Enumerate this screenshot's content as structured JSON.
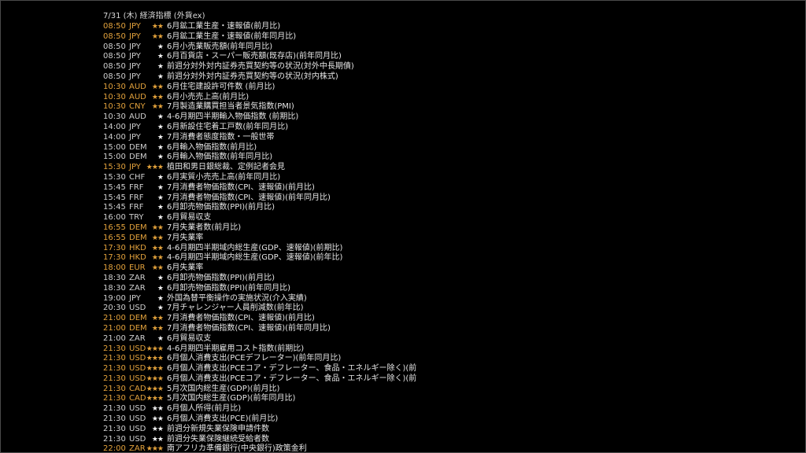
{
  "header": "7/31 (木) 経済指標 (外貨ex)",
  "colors": {
    "normal": "#cfcfcf",
    "highlight": "#e3a23c",
    "text": "#e6e6e6",
    "background": "#000000"
  },
  "rows": [
    {
      "time": "08:50",
      "currency": "JPY",
      "stars": "★★",
      "title": "6月鉱工業生産・速報値(前月比)",
      "hl": true
    },
    {
      "time": "08:50",
      "currency": "JPY",
      "stars": "★★",
      "title": "6月鉱工業生産・速報値(前年同月比)",
      "hl": true
    },
    {
      "time": "08:50",
      "currency": "JPY",
      "stars": "★",
      "title": "6月小売業販売額(前年同月比)",
      "hl": false
    },
    {
      "time": "08:50",
      "currency": "JPY",
      "stars": "★",
      "title": "6月百貨店・スーパー販売額(既存店)(前年同月比)",
      "hl": false
    },
    {
      "time": "08:50",
      "currency": "JPY",
      "stars": "★",
      "title": "前週分対外対内証券売買契約等の状況(対外中長期債)",
      "hl": false
    },
    {
      "time": "08:50",
      "currency": "JPY",
      "stars": "★",
      "title": "前週分対外対内証券売買契約等の状況(対内株式)",
      "hl": false
    },
    {
      "time": "10:30",
      "currency": "AUD",
      "stars": "★★",
      "title": "6月住宅建設許可件数 (前月比)",
      "hl": true
    },
    {
      "time": "10:30",
      "currency": "AUD",
      "stars": "★★",
      "title": "6月小売売上高(前月比)",
      "hl": true
    },
    {
      "time": "10:30",
      "currency": "CNY",
      "stars": "★★",
      "title": "7月製造業購買担当者景気指数(PMI)",
      "hl": true
    },
    {
      "time": "10:30",
      "currency": "AUD",
      "stars": "★",
      "title": "4-6月期四半期輸入物価指数 (前期比)",
      "hl": false
    },
    {
      "time": "14:00",
      "currency": "JPY",
      "stars": "★",
      "title": "6月新設住宅着工戸数(前年同月比)",
      "hl": false
    },
    {
      "time": "14:00",
      "currency": "JPY",
      "stars": "★",
      "title": "7月消費者態度指数・一般世帯",
      "hl": false
    },
    {
      "time": "15:00",
      "currency": "DEM",
      "stars": "★",
      "title": "6月輸入物価指数(前月比)",
      "hl": false
    },
    {
      "time": "15:00",
      "currency": "DEM",
      "stars": "★",
      "title": "6月輸入物価指数(前年同月比)",
      "hl": false
    },
    {
      "time": "15:30",
      "currency": "JPY",
      "stars": "★★★",
      "title": "植田和男日銀総裁、定例記者会見",
      "hl": true
    },
    {
      "time": "15:30",
      "currency": "CHF",
      "stars": "★",
      "title": "6月実質小売売上高(前年同月比)",
      "hl": false
    },
    {
      "time": "15:45",
      "currency": "FRF",
      "stars": "★",
      "title": "7月消費者物価指数(CPI、速報値)(前月比)",
      "hl": false
    },
    {
      "time": "15:45",
      "currency": "FRF",
      "stars": "★",
      "title": "7月消費者物価指数(CPI、速報値)(前年同月比)",
      "hl": false
    },
    {
      "time": "15:45",
      "currency": "FRF",
      "stars": "★",
      "title": "6月卸売物価指数(PPI)(前月比)",
      "hl": false
    },
    {
      "time": "16:00",
      "currency": "TRY",
      "stars": "★",
      "title": "6月貿易収支",
      "hl": false
    },
    {
      "time": "16:55",
      "currency": "DEM",
      "stars": "★★",
      "title": "7月失業者数(前月比)",
      "hl": true
    },
    {
      "time": "16:55",
      "currency": "DEM",
      "stars": "★★",
      "title": "7月失業率",
      "hl": true
    },
    {
      "time": "17:30",
      "currency": "HKD",
      "stars": "★★",
      "title": "4-6月期四半期域内総生産(GDP、速報値)(前期比)",
      "hl": true
    },
    {
      "time": "17:30",
      "currency": "HKD",
      "stars": "★★",
      "title": "4-6月期四半期域内総生産(GDP、速報値)(前年比)",
      "hl": true
    },
    {
      "time": "18:00",
      "currency": "EUR",
      "stars": "★★",
      "title": "6月失業率",
      "hl": true
    },
    {
      "time": "18:30",
      "currency": "ZAR",
      "stars": "★",
      "title": "6月卸売物価指数(PPI)(前月比)",
      "hl": false
    },
    {
      "time": "18:30",
      "currency": "ZAR",
      "stars": "★",
      "title": "6月卸売物価指数(PPI)(前年同月比)",
      "hl": false
    },
    {
      "time": "19:00",
      "currency": "JPY",
      "stars": "★",
      "title": "外国為替平衡操作の実施状況(介入実績)",
      "hl": false
    },
    {
      "time": "20:30",
      "currency": "USD",
      "stars": "★",
      "title": "7月チャレンジャー人員削減数(前年比)",
      "hl": false
    },
    {
      "time": "21:00",
      "currency": "DEM",
      "stars": "★★",
      "title": "7月消費者物価指数(CPI、速報値)(前月比)",
      "hl": true
    },
    {
      "time": "21:00",
      "currency": "DEM",
      "stars": "★★",
      "title": "7月消費者物価指数(CPI、速報値)(前年同月比)",
      "hl": true
    },
    {
      "time": "21:00",
      "currency": "ZAR",
      "stars": "★",
      "title": "6月貿易収支",
      "hl": false
    },
    {
      "time": "21:30",
      "currency": "USD",
      "stars": "★★★",
      "title": "4-6月期四半期雇用コスト指数(前期比)",
      "hl": true
    },
    {
      "time": "21:30",
      "currency": "USD",
      "stars": "★★★",
      "title": "6月個人消費支出(PCEデフレーター)(前年同月比)",
      "hl": true
    },
    {
      "time": "21:30",
      "currency": "USD",
      "stars": "★★★",
      "title": "6月個人消費支出(PCEコア・デフレーター、食品・エネルギー除く)(前",
      "hl": true
    },
    {
      "time": "21:30",
      "currency": "USD",
      "stars": "★★★",
      "title": "6月個人消費支出(PCEコア・デフレーター、食品・エネルギー除く)(前",
      "hl": true
    },
    {
      "time": "21:30",
      "currency": "CAD",
      "stars": "★★★",
      "title": "5月次国内総生産(GDP)(前月比)",
      "hl": true
    },
    {
      "time": "21:30",
      "currency": "CAD",
      "stars": "★★★",
      "title": "5月次国内総生産(GDP)(前年同月比)",
      "hl": true
    },
    {
      "time": "21:30",
      "currency": "USD",
      "stars": "★★",
      "title": "6月個人所得(前月比)",
      "hl": false
    },
    {
      "time": "21:30",
      "currency": "USD",
      "stars": "★★",
      "title": "6月個人消費支出(PCE)(前月比)",
      "hl": false
    },
    {
      "time": "21:30",
      "currency": "USD",
      "stars": "★★",
      "title": "前週分新規失業保険申請件数",
      "hl": false
    },
    {
      "time": "21:30",
      "currency": "USD",
      "stars": "★★",
      "title": "前週分失業保険継続受給者数",
      "hl": false
    },
    {
      "time": "22:00",
      "currency": "ZAR",
      "stars": "★★★",
      "title": "南アフリカ準備銀行(中央銀行)政策金利",
      "hl": true
    }
  ]
}
